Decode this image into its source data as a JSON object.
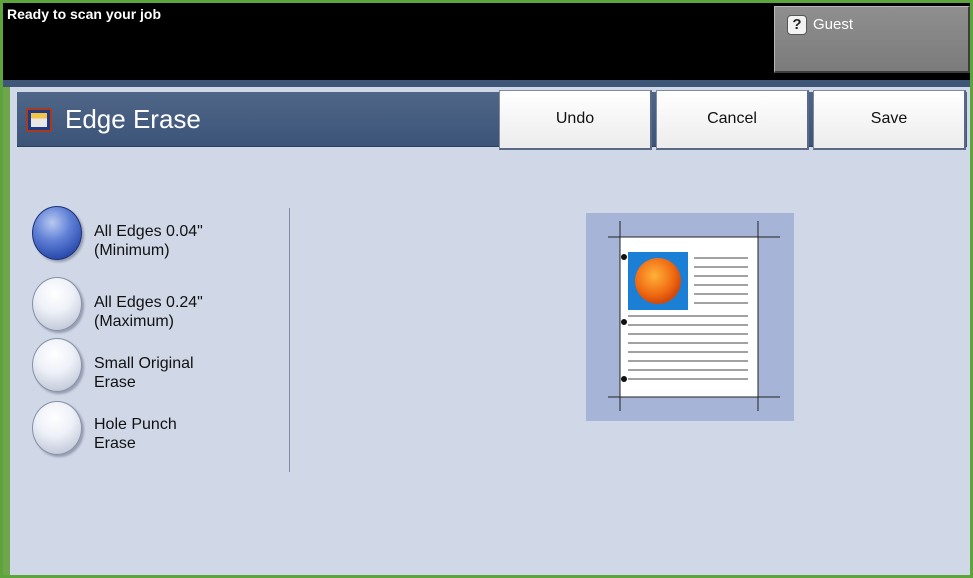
{
  "status": {
    "message": "Ready to scan your job",
    "user_label": "Guest",
    "user_icon": "help-question-icon"
  },
  "title_bar": {
    "title": "Edge Erase",
    "icon": "edge-erase-feature-icon",
    "buttons": {
      "undo": "Undo",
      "cancel": "Cancel",
      "save": "Save"
    }
  },
  "options": [
    {
      "label": "All Edges 0.04\"\n(Minimum)",
      "selected": true
    },
    {
      "label": "All Edges 0.24\"\n(Maximum)",
      "selected": false
    },
    {
      "label": "Small Original\nErase",
      "selected": false
    },
    {
      "label": "Hole Punch\nErase",
      "selected": false
    }
  ],
  "colors": {
    "frame": "#5ea43c",
    "header_bg": "#000000",
    "title_bar": "#465d80",
    "panel": "#d0d8e8",
    "selected_radio": "#2e4fb0"
  }
}
